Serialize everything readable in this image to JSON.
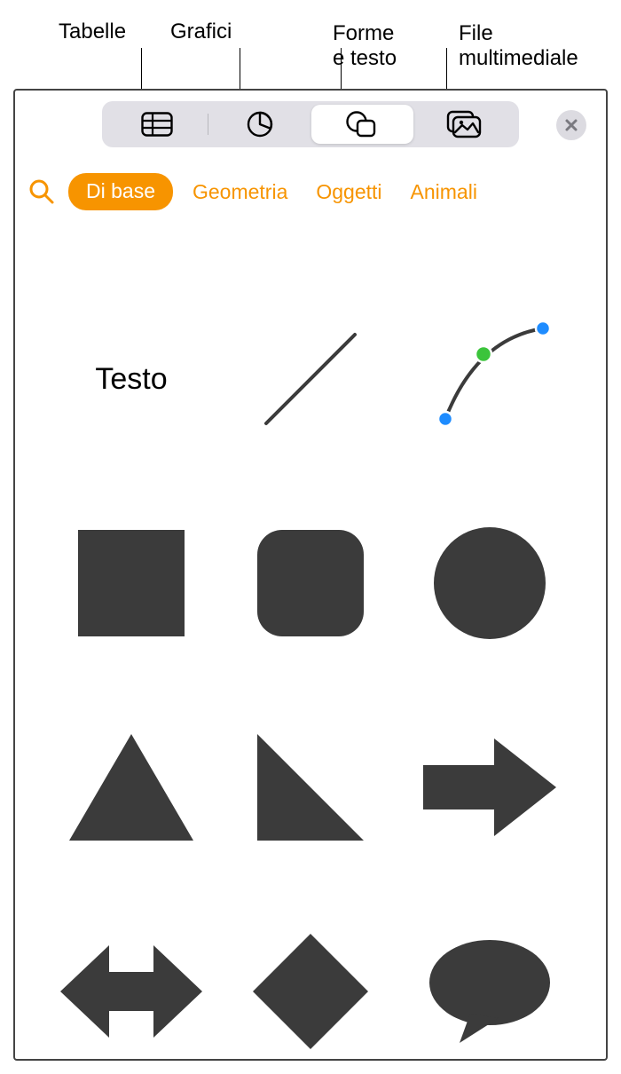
{
  "callouts": {
    "tables": "Tabelle",
    "charts": "Grafici",
    "shapes": "Forme\ne testo",
    "media": "File\nmultimediale"
  },
  "toolbar": {
    "tables_icon": "table-icon",
    "charts_icon": "pie-chart-icon",
    "shapes_icon": "shapes-icon",
    "media_icon": "gallery-icon",
    "close_icon": "close-icon"
  },
  "categories": {
    "active": "Di base",
    "items": [
      "Geometria",
      "Oggetti",
      "Animali"
    ]
  },
  "shapes": {
    "text_label": "Testo",
    "items": [
      "text",
      "line",
      "curve",
      "square",
      "rounded-square",
      "circle",
      "triangle",
      "right-triangle",
      "arrow-right",
      "arrow-horizontal",
      "diamond",
      "speech-bubble"
    ]
  },
  "colors": {
    "accent": "#f79400",
    "shape": "#3b3b3b"
  }
}
